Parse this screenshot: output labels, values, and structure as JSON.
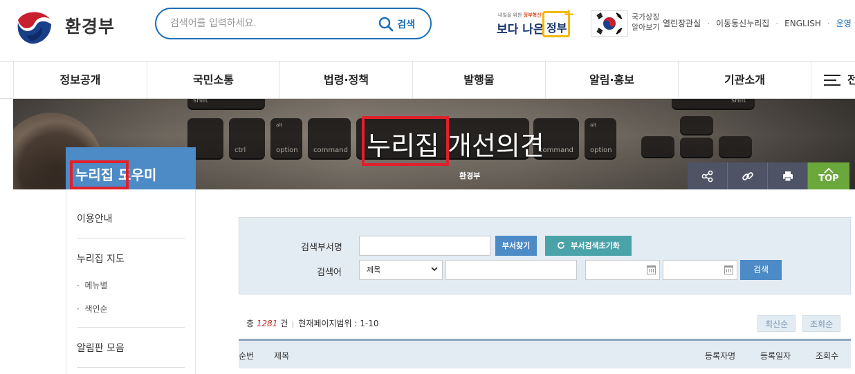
{
  "header": {
    "org_name": "환경부",
    "search_placeholder": "검색어를 입력하세요.",
    "search_button": "검색",
    "slogan_small_prefix": "내일을 위한 ",
    "slogan_small_emph": "정부혁신",
    "slogan_big": "보다 나은",
    "slogan_box": "정부",
    "national_symbol_line1": "국가상징",
    "national_symbol_line2": "알아보기",
    "util_links": [
      "열린장관실",
      "이동통신누리집",
      "ENGLISH",
      "운영"
    ]
  },
  "gnb": {
    "items": [
      "정보공개",
      "국민소통",
      "법령·정책",
      "발행물",
      "알림·홍보",
      "기관소개"
    ],
    "all_menu": "전"
  },
  "banner": {
    "title": "누리집 개선의견",
    "subtitle": "환경부",
    "keys": [
      "shift",
      "ctrl",
      "option",
      "command",
      "command",
      "option",
      "shift"
    ],
    "tools": [
      "share-icon",
      "link-icon",
      "print-icon"
    ],
    "top_label": "TOP",
    "highlight_color": "#e0202c"
  },
  "lnb": {
    "title": "누리집 도우미",
    "items": [
      "이용안내",
      "누리집 지도",
      "알림판 모음"
    ],
    "subitems": [
      "메뉴별",
      "색인순"
    ]
  },
  "search_form": {
    "dept_label": "검색부서명",
    "dept_value": "",
    "find_dept_button": "부서찾기",
    "reset_button": "부서검색초기화",
    "keyword_label": "검색어",
    "field_select": "제목",
    "keyword_value": "",
    "date_from": "",
    "date_to": "",
    "search_button": "검색"
  },
  "list": {
    "total_prefix": "총",
    "total_count": "1281",
    "total_suffix": "건",
    "page_range_label": "현재페이지범위 : 1-10",
    "sort_latest": "최신순",
    "sort_views": "조회순",
    "columns": [
      "순번",
      "제목",
      "등록자명",
      "등록일자",
      "조회수"
    ]
  },
  "colors": {
    "brand_blue": "#1f6fb6",
    "lnb_blue": "#4d8bc6",
    "top_green": "#6aa83b",
    "tool_dark": "#4e5366"
  }
}
